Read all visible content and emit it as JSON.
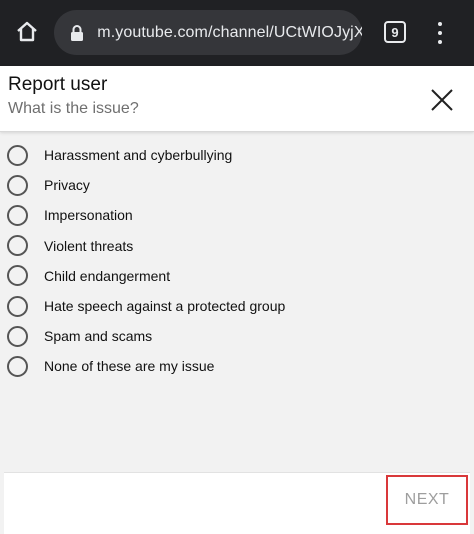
{
  "browser": {
    "url": "m.youtube.com/channel/UCtWIOJyjXx",
    "tab_count": "9"
  },
  "dialog": {
    "title": "Report user",
    "subtitle": "What is the issue?",
    "options": [
      "Harassment and cyberbullying",
      "Privacy",
      "Impersonation",
      "Violent threats",
      "Child endangerment",
      "Hate speech against a protected group",
      "Spam and scams",
      "None of these are my issue"
    ],
    "next_label": "NEXT"
  },
  "colors": {
    "toolbar_bg": "#202124",
    "urlbar_bg": "#35363a",
    "highlight_border": "#d9383a"
  },
  "icons": [
    "home-icon",
    "lock-icon",
    "tab-switcher-icon",
    "overflow-menu-icon",
    "close-icon",
    "radio-icon"
  ]
}
